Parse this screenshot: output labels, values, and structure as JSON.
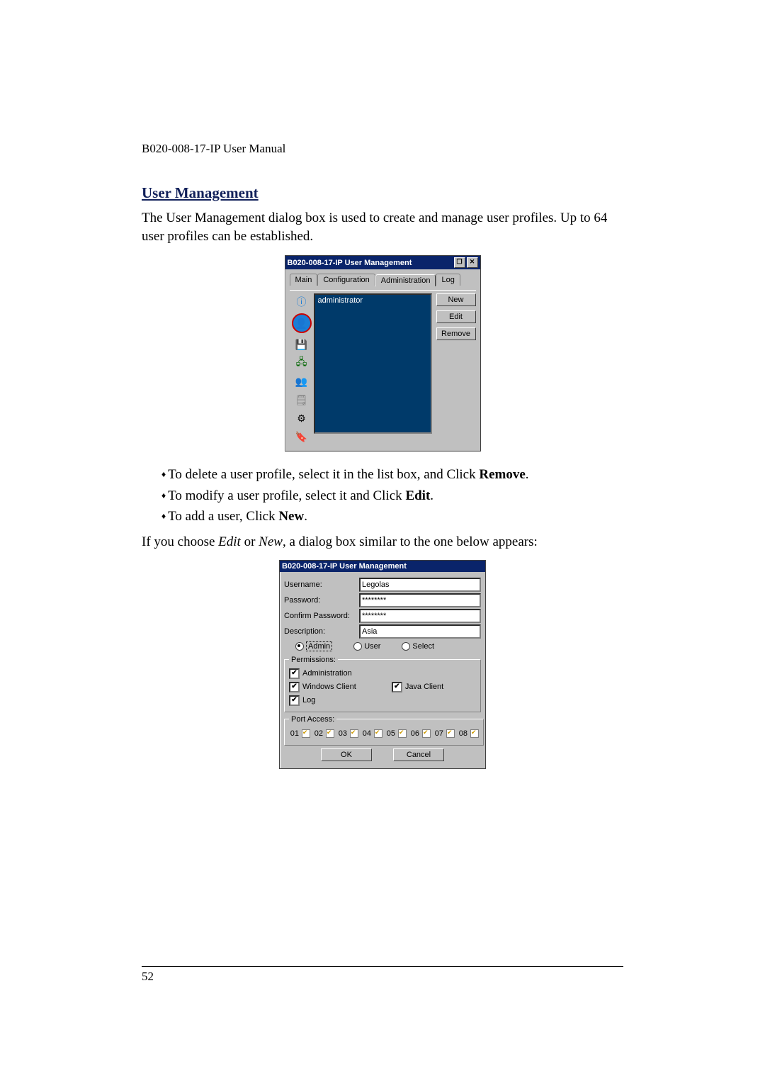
{
  "doc": {
    "running_header": "B020-008-17-IP User Manual",
    "section_title": "User Management",
    "intro": "The User Management dialog box is used to create and manage user profiles. Up to 64 user profiles can be established.",
    "bullets": [
      {
        "pre": "To delete a user profile, select it in the list box, and Click ",
        "bold": "Remove",
        "post": "."
      },
      {
        "pre": "To modify a user profile, select it and Click ",
        "bold": "Edit",
        "post": "."
      },
      {
        "pre": "To add a user, Click ",
        "bold": "New",
        "post": "."
      }
    ],
    "after": {
      "pre": "If you choose ",
      "i1": "Edit",
      "mid": " or ",
      "i2": "New",
      "post": ", a dialog box similar to the one below appears:"
    },
    "page_number": "52"
  },
  "dlg1": {
    "title": "B020-008-17-IP User Management",
    "tabs": [
      "Main",
      "Configuration",
      "Administration",
      "Log"
    ],
    "active_tab": 2,
    "list_items": [
      "administrator"
    ],
    "buttons": [
      "New",
      "Edit",
      "Remove"
    ],
    "icons": [
      "info-icon",
      "user-icon",
      "disk-icon",
      "network-icon",
      "adduser-icon",
      "log-icon",
      "gear-icon",
      "cert-icon"
    ]
  },
  "dlg2": {
    "title": "B020-008-17-IP User Management",
    "fields": {
      "username_label": "Username:",
      "username_value": "Legolas",
      "password_label": "Password:",
      "password_value": "********",
      "confirm_label": "Confirm Password:",
      "confirm_value": "********",
      "description_label": "Description:",
      "description_value": "Asia"
    },
    "role_options": [
      "Admin",
      "User",
      "Select"
    ],
    "role_selected": 0,
    "permissions_legend": "Permissions:",
    "permissions": [
      {
        "label": "Administration",
        "checked": true
      },
      {
        "label": "Windows Client",
        "checked": true
      },
      {
        "label": "Java Client",
        "checked": true
      },
      {
        "label": "Log",
        "checked": true
      }
    ],
    "portaccess_legend": "Port Access:",
    "ports": [
      "01",
      "02",
      "03",
      "04",
      "05",
      "06",
      "07",
      "08"
    ],
    "ok_label": "OK",
    "cancel_label": "Cancel"
  }
}
